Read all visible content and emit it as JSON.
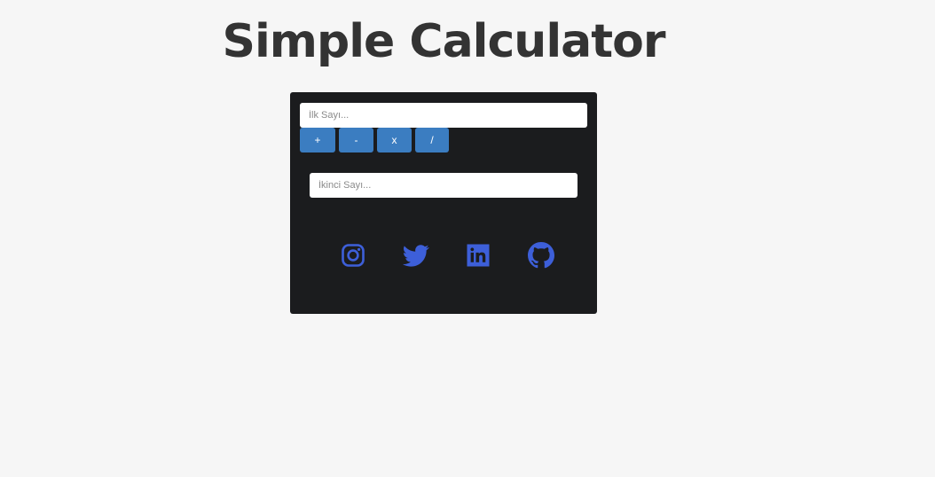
{
  "page": {
    "title": "Simple Calculator"
  },
  "calculator": {
    "first_input": {
      "placeholder": "İlk Sayı...",
      "value": ""
    },
    "second_input": {
      "placeholder": "İkinci Sayı...",
      "value": ""
    },
    "operators": [
      {
        "label": "+"
      },
      {
        "label": "-"
      },
      {
        "label": "x"
      },
      {
        "label": "/"
      }
    ]
  },
  "social": {
    "icons": [
      "instagram-icon",
      "twitter-icon",
      "linkedin-icon",
      "github-icon"
    ]
  },
  "colors": {
    "background": "#f6f6f6",
    "title": "#333333",
    "panel": "#1b1c1e",
    "operator_button": "#3b7dc1",
    "social_icon": "#3d5fd9"
  }
}
